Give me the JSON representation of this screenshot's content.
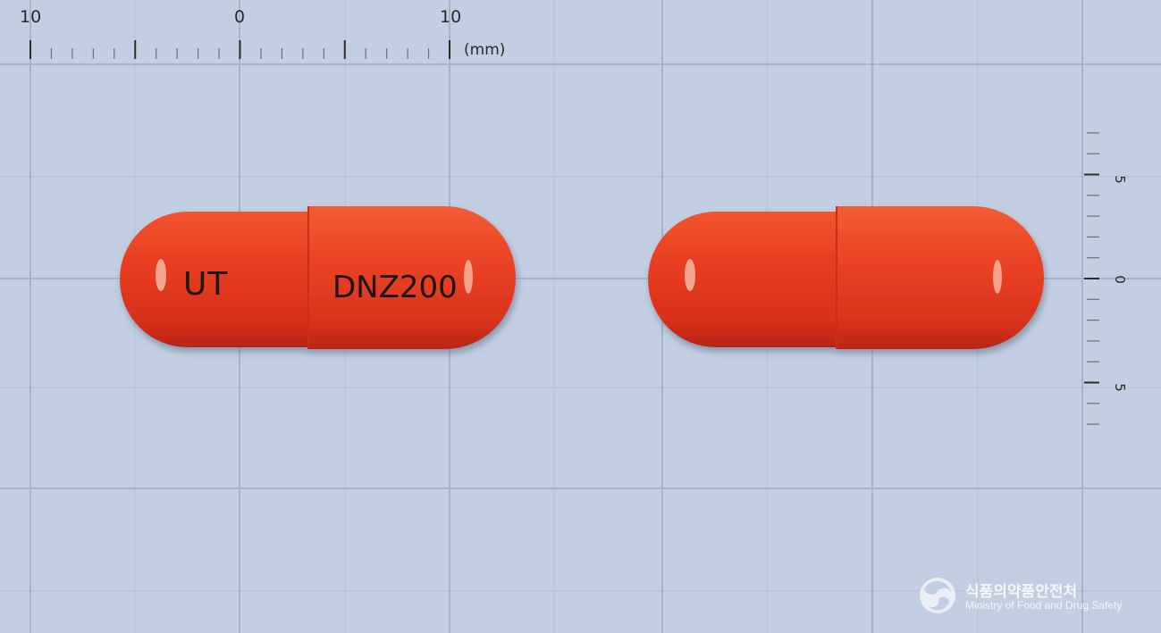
{
  "top_ruler": {
    "labels": [
      "10",
      "0",
      "10"
    ],
    "unit": "(mm)"
  },
  "side_ruler": {
    "labels": [
      "5",
      "0",
      "5"
    ]
  },
  "capsules": [
    {
      "side": "front",
      "imprint_left": "UT",
      "imprint_right": "DNZ200",
      "color": "#e83a20"
    },
    {
      "side": "back",
      "imprint_left": "",
      "imprint_right": "",
      "color": "#e83a20"
    }
  ],
  "watermark": {
    "korean": "식품의약품안전처",
    "english": "Ministry of Food and Drug Safety"
  },
  "colors": {
    "background": "#c2cfe2",
    "grid": "#a7b4c6",
    "capsule": "#e83a20",
    "capsule_shadow": "#b42414"
  }
}
